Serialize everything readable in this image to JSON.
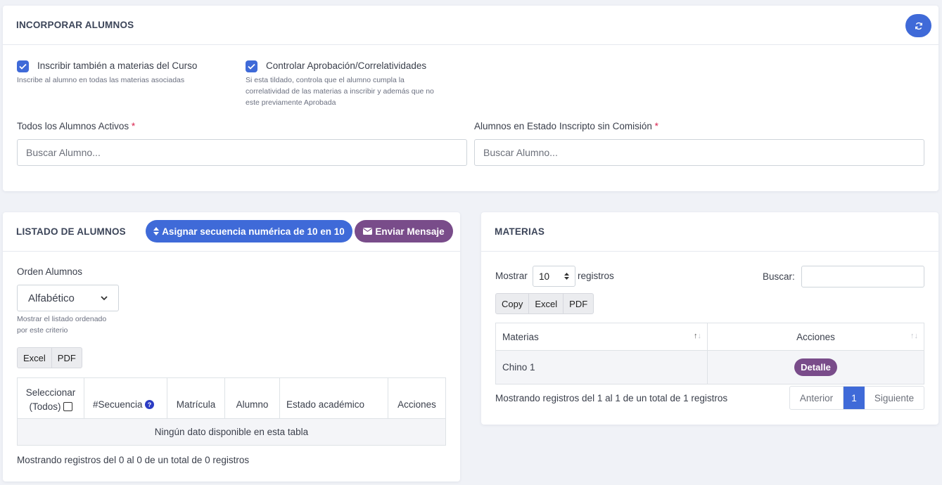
{
  "incorporar": {
    "title": "INCORPORAR ALUMNOS",
    "refresh_icon": "refresh-icon",
    "opt1": {
      "label": "Inscribir también a materias del Curso",
      "help": "Inscribe al alumno en todas las materias asociadas",
      "checked": true
    },
    "opt2": {
      "label": "Controlar Aprobación/Correlatividades",
      "help_lines": [
        "Si esta tildado, controla que el alumno cumpla la",
        "correlatividad de las materias a inscribir y además que no",
        "este previamente Aprobada"
      ],
      "checked": true
    },
    "field1": {
      "label": "Todos los Alumnos Activos",
      "required": "*",
      "placeholder": "Buscar Alumno..."
    },
    "field2": {
      "label": "Alumnos en Estado Inscripto sin Comisión",
      "required": "*",
      "placeholder": "Buscar Alumno..."
    }
  },
  "listado": {
    "title": "LISTADO DE ALUMNOS",
    "assign_button": "Asignar secuencia numérica de 10 en 10",
    "message_button": "Enviar Mensaje",
    "order_label": "Orden Alumnos",
    "order_value": "Alfabético",
    "order_help_lines": [
      "Mostrar el listado ordenado",
      "por este criterio"
    ],
    "export_buttons": [
      "Excel",
      "PDF"
    ],
    "columns": {
      "select_line1": "Seleccionar",
      "select_line2": "(Todos)",
      "sequence": "#Secuencia",
      "matricula": "Matrícula",
      "alumno": "Alumno",
      "estado": "Estado académico",
      "acciones": "Acciones"
    },
    "empty": "Ningún dato disponible en esta tabla",
    "info": "Mostrando registros del 0 al 0 de un total de 0 registros"
  },
  "materias": {
    "title": "MATERIAS",
    "show_label": "Mostrar",
    "show_value": "10",
    "records_label": "registros",
    "search_label": "Buscar:",
    "export_buttons": [
      "Copy",
      "Excel",
      "PDF"
    ],
    "columns": {
      "materias": "Materias",
      "acciones": "Acciones"
    },
    "rows": [
      {
        "materia": "Chino 1",
        "action": "Detalle"
      }
    ],
    "info": "Mostrando registros del 1 al 1 de un total de 1 registros",
    "pagination": {
      "prev": "Anterior",
      "current": "1",
      "next": "Siguiente"
    }
  },
  "colors": {
    "primary": "#3f6ad8",
    "purple": "#794c8a",
    "required": "#d92550"
  }
}
